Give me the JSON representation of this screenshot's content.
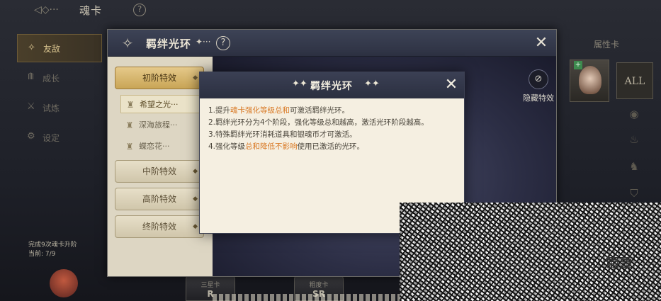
{
  "background": {
    "top_bar": {
      "back_icon": "winged-arrow-back-icon",
      "title": "魂卡",
      "help_icon": "?"
    },
    "left_nav": {
      "items": [
        {
          "label": "友敌",
          "icon": "ornate-star-icon",
          "active": true
        },
        {
          "label": "成长",
          "icon": "growth-icon",
          "active": false
        },
        {
          "label": "试炼",
          "icon": "trial-icon",
          "active": false
        },
        {
          "label": "设定",
          "icon": "settings-icon",
          "active": false
        }
      ],
      "progress_line1": "完成9次魂卡升阶",
      "progress_line2": "当前: 7/9"
    },
    "right_panel": {
      "attribute_card_label": "属性卡",
      "all_label": "ALL",
      "card_plus": "+",
      "element_icons": [
        "wind-element-icon",
        "fire-element-icon",
        "earth-element-icon",
        "shield-element-icon"
      ]
    },
    "bottom_buttons": [
      {
        "label": "三星卡",
        "level": "R"
      },
      {
        "label": "粗度卡",
        "level": "SR"
      }
    ]
  },
  "outer_panel": {
    "title": "羁绊光环",
    "title_deco": "✦···",
    "help": "?",
    "close": "✕",
    "tabs": [
      {
        "label": "初阶特效",
        "active": true,
        "expanded": true,
        "items": [
          {
            "label": "希望之光···",
            "active": true
          },
          {
            "label": "深海旅程···",
            "active": false
          },
          {
            "label": "蝶恋花···",
            "active": false
          }
        ]
      },
      {
        "label": "中阶特效",
        "active": false,
        "expanded": false
      },
      {
        "label": "高阶特效",
        "active": false,
        "expanded": false
      },
      {
        "label": "终阶特效",
        "active": false,
        "expanded": false
      }
    ],
    "hide_effects_label": "隐藏特效"
  },
  "inner_dialog": {
    "title": "羁绊光环",
    "star_left": "✦✦",
    "star_right": "✦✦",
    "close": "✕",
    "rules": [
      {
        "prefix": "1.提升",
        "highlight": "魂卡强化等级总和",
        "suffix": "可激活羁绊光环。"
      },
      {
        "prefix": "2.羁绊光环分为4个阶段，强化等级总和越高，激活光环阶段越高。",
        "highlight": "",
        "suffix": ""
      },
      {
        "prefix": "3.特殊羁绊光环消耗道具和银魂币才可激活。",
        "highlight": "",
        "suffix": ""
      },
      {
        "prefix": "4.强化等级",
        "highlight": "总和降低不影响",
        "suffix": "使用已激活的光环。"
      }
    ],
    "highlight_color": "#d97a26"
  }
}
